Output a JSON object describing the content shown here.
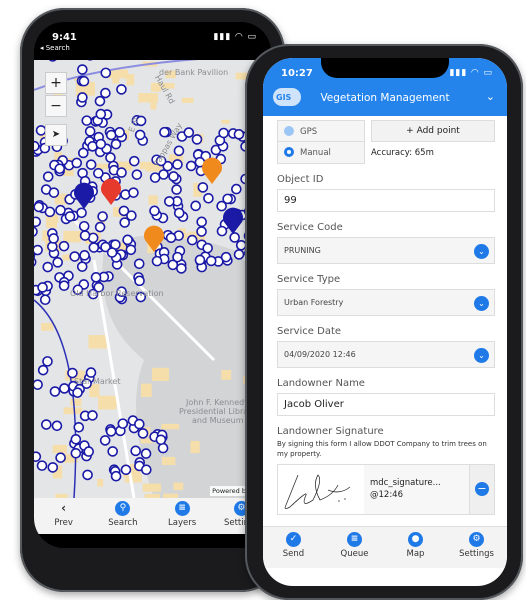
{
  "colors": {
    "accent": "#2484ec",
    "marker_blue": "#1a1aa6",
    "marker_red": "#e53a2c",
    "marker_orange": "#f08a1c"
  },
  "left_phone": {
    "status_time": "9:41",
    "back_link": "◂ Search",
    "map": {
      "labels": [
        "der Bank Pavilion",
        "Haul Rd",
        "E St",
        "Pappas Way",
        "Old Harbor Reservation",
        "Star Market",
        "John F. Kennedy",
        "Presidential Library",
        "and Museum"
      ],
      "zoom_in": "+",
      "zoom_out": "−",
      "locate_icon": "navigation-arrow-icon",
      "attribution": "Powered by GIS"
    },
    "bottom_bar": [
      {
        "label": "Prev",
        "icon": "chevron-left-icon"
      },
      {
        "label": "Search",
        "icon": "search-icon"
      },
      {
        "label": "Layers",
        "icon": "layers-icon"
      },
      {
        "label": "Settings",
        "icon": "gear-icon"
      }
    ]
  },
  "right_phone": {
    "status_time": "10:27",
    "header": {
      "logo": "GIS",
      "title": "Vegetation Management"
    },
    "location": {
      "gps": "GPS",
      "manual": "Manual",
      "selected": "Manual",
      "add_point": "+ Add point",
      "accuracy": "Accuracy: 65m"
    },
    "fields": {
      "object_id": {
        "label": "Object ID",
        "value": "99"
      },
      "service_code": {
        "label": "Service Code",
        "value": "PRUNING"
      },
      "service_type": {
        "label": "Service Type",
        "value": "Urban Forestry"
      },
      "service_date": {
        "label": "Service Date",
        "value": "04/09/2020 12:46"
      },
      "landowner_name": {
        "label": "Landowner Name",
        "value": "Jacob Oliver"
      },
      "landowner_signature": {
        "label": "Landowner Signature",
        "note": "By signing this form I allow DDOT Company to trim trees on my property.",
        "file": "mdc_signature...",
        "time": "@12:46"
      }
    },
    "bottom_bar": [
      {
        "label": "Send",
        "icon": "check-icon"
      },
      {
        "label": "Queue",
        "icon": "list-icon"
      },
      {
        "label": "Map",
        "icon": "map-pin-icon"
      },
      {
        "label": "Settings",
        "icon": "gear-icon"
      }
    ]
  }
}
